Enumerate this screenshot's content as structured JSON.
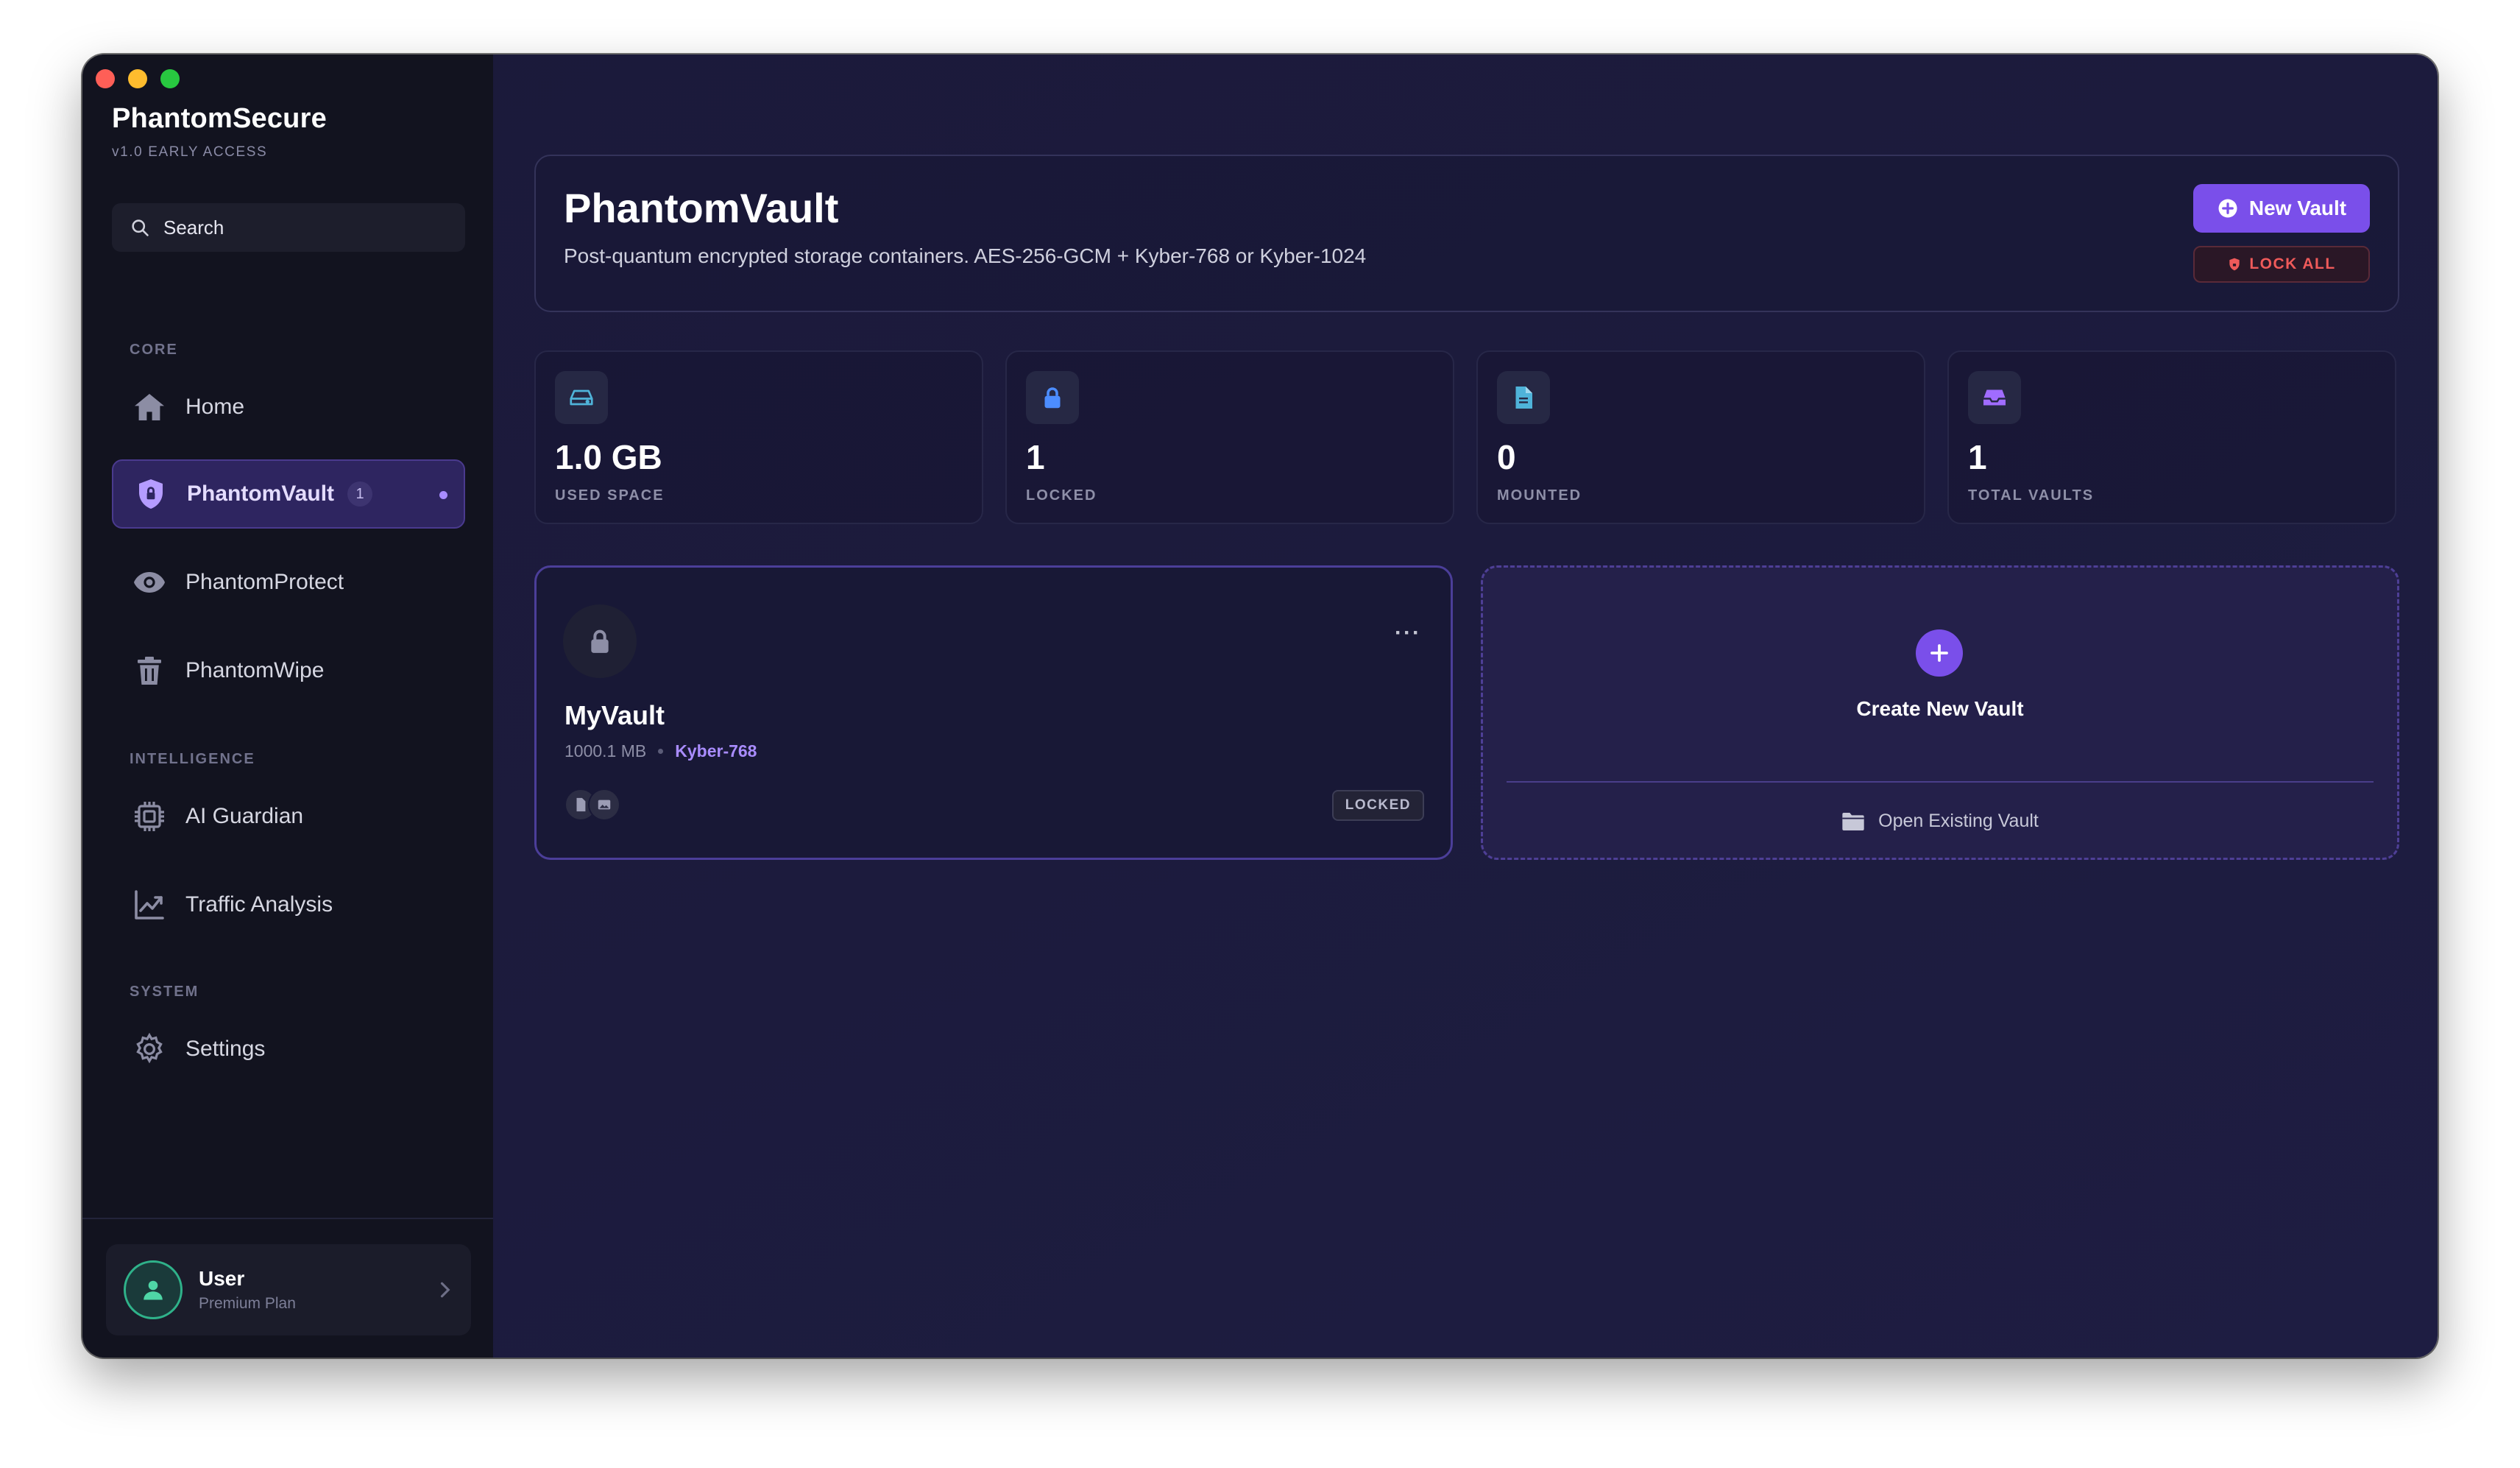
{
  "app": {
    "name": "PhantomSecure",
    "version": "v1.0 EARLY ACCESS"
  },
  "search": {
    "placeholder": "Search"
  },
  "sidebar": {
    "sections": [
      {
        "label": "CORE"
      },
      {
        "label": "INTELLIGENCE"
      },
      {
        "label": "SYSTEM"
      }
    ],
    "items": [
      {
        "label": "Home",
        "icon": "home-icon"
      },
      {
        "label": "PhantomVault",
        "icon": "shield-icon",
        "badge": "1",
        "active": true
      },
      {
        "label": "PhantomProtect",
        "icon": "eye-icon"
      },
      {
        "label": "PhantomWipe",
        "icon": "trash-icon"
      },
      {
        "label": "AI Guardian",
        "icon": "cpu-icon"
      },
      {
        "label": "Traffic Analysis",
        "icon": "chart-line-icon"
      },
      {
        "label": "Settings",
        "icon": "gear-icon"
      }
    ]
  },
  "user": {
    "name": "User",
    "plan": "Premium Plan"
  },
  "header": {
    "title": "PhantomVault",
    "subtitle": "Post-quantum encrypted storage containers. AES-256-GCM + Kyber-768 or Kyber-1024",
    "new_vault_label": "New Vault",
    "lock_all_label": "LOCK ALL"
  },
  "stats": [
    {
      "value": "1.0 GB",
      "label": "USED SPACE",
      "icon": "drive-icon",
      "color": "#4fb3d9"
    },
    {
      "value": "1",
      "label": "LOCKED",
      "icon": "lock-icon",
      "color": "#4c8dff"
    },
    {
      "value": "0",
      "label": "MOUNTED",
      "icon": "file-icon",
      "color": "#4fb3d9"
    },
    {
      "value": "1",
      "label": "TOTAL VAULTS",
      "icon": "inbox-icon",
      "color": "#a06cff"
    }
  ],
  "vaults": [
    {
      "name": "MyVault",
      "size": "1000.1 MB",
      "algorithm": "Kyber-768",
      "status": "LOCKED",
      "menu": "···"
    }
  ],
  "create_vault": {
    "label": "Create New Vault",
    "open_existing_label": "Open Existing Vault"
  },
  "colors": {
    "accent": "#7a4fea",
    "danger": "#ef5a5a",
    "sidebar_bg": "#12131f",
    "main_bg": "#1c1b3d"
  }
}
